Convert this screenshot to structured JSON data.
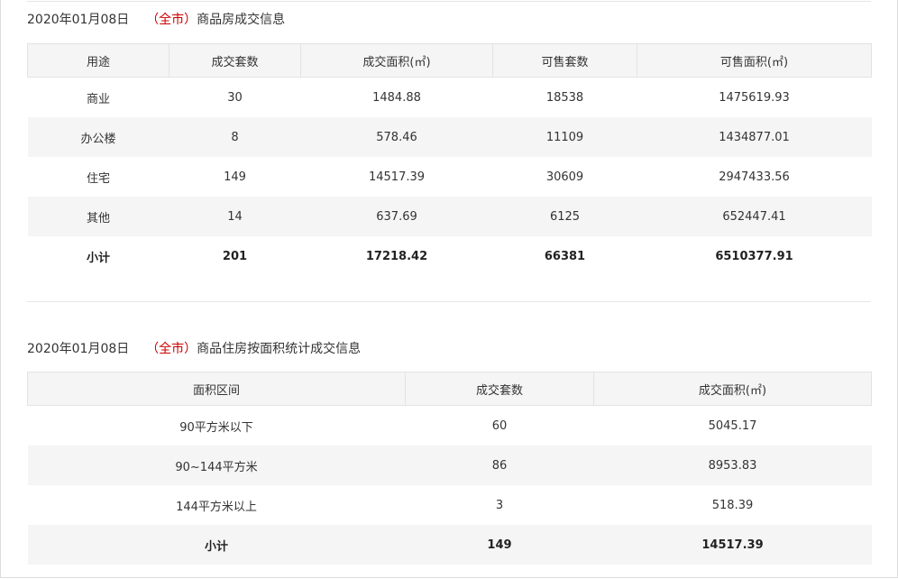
{
  "section1": {
    "date": "2020年01月08日",
    "open_paren": "（",
    "city": "全市",
    "close_paren": "）",
    "title": "商品房成交信息",
    "headers": [
      "用途",
      "成交套数",
      "成交面积(㎡)",
      "可售套数",
      "可售面积(㎡)"
    ],
    "rows": [
      [
        "商业",
        "30",
        "1484.88",
        "18538",
        "1475619.93"
      ],
      [
        "办公楼",
        "8",
        "578.46",
        "11109",
        "1434877.01"
      ],
      [
        "住宅",
        "149",
        "14517.39",
        "30609",
        "2947433.56"
      ],
      [
        "其他",
        "14",
        "637.69",
        "6125",
        "652447.41"
      ]
    ],
    "total": [
      "小计",
      "201",
      "17218.42",
      "66381",
      "6510377.91"
    ]
  },
  "section2": {
    "date": "2020年01月08日",
    "open_paren": "（",
    "city": "全市",
    "close_paren": "）",
    "title": "商品住房按面积统计成交信息",
    "headers": [
      "面积区间",
      "成交套数",
      "成交面积(㎡)"
    ],
    "rows": [
      [
        "90平方米以下",
        "60",
        "5045.17"
      ],
      [
        "90~144平方米",
        "86",
        "8953.83"
      ],
      [
        "144平方米以上",
        "3",
        "518.39"
      ]
    ],
    "total": [
      "小计",
      "149",
      "14517.39"
    ]
  }
}
